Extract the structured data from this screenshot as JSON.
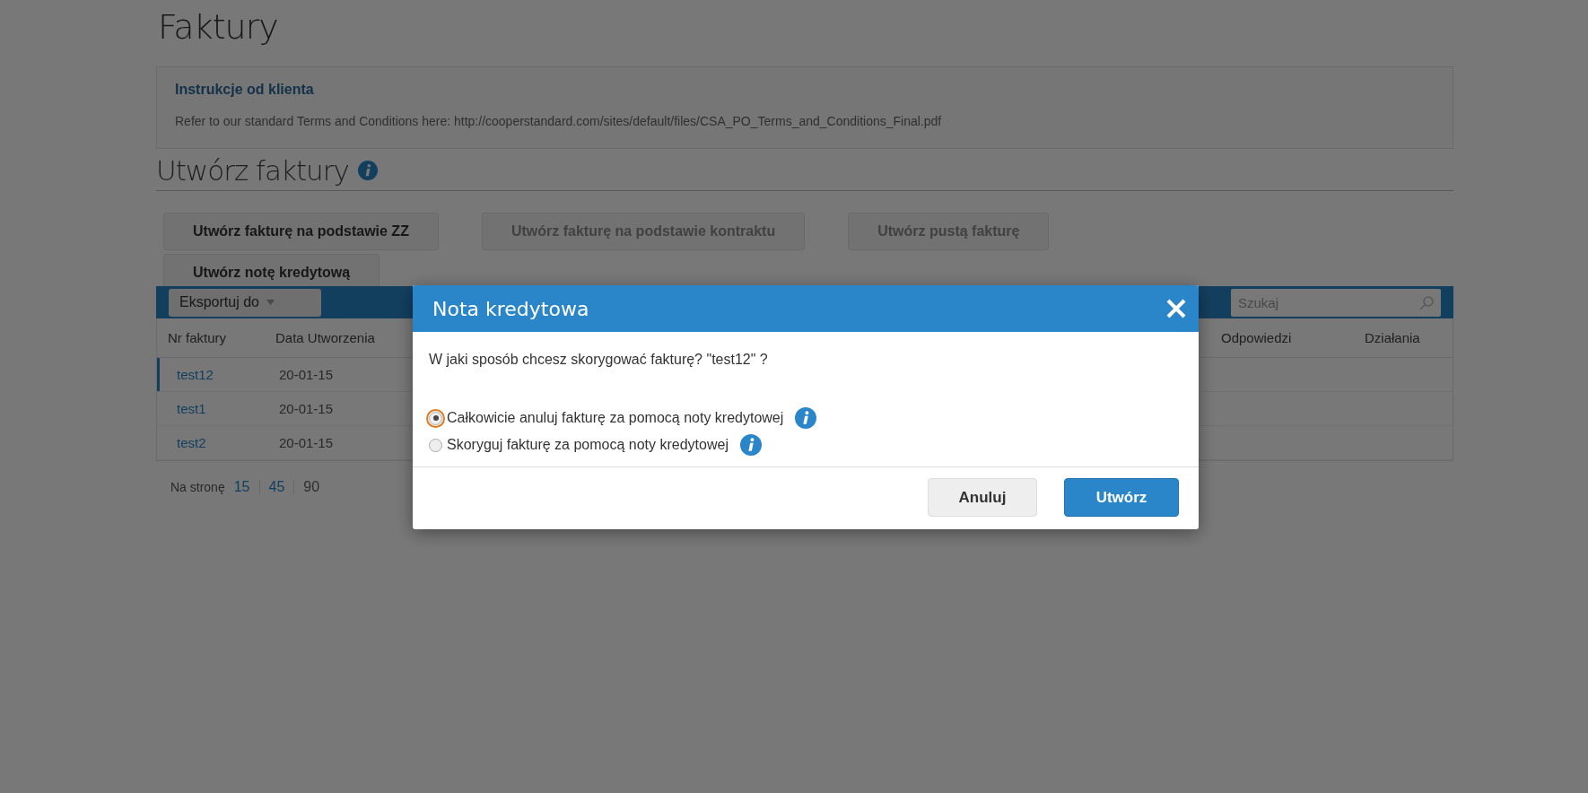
{
  "page": {
    "title": "Faktury"
  },
  "instructions": {
    "heading": "Instrukcje od klienta",
    "text": "Refer to our standard Terms and Conditions here: http://cooperstandard.com/sites/default/files/CSA_PO_Terms_and_Conditions_Final.pdf"
  },
  "create_section": {
    "title": "Utwórz faktury",
    "buttons": [
      {
        "label": "Utwórz fakturę na podstawie ZZ",
        "disabled": false
      },
      {
        "label": "Utwórz fakturę na podstawie kontraktu",
        "disabled": true
      },
      {
        "label": "Utwórz pustą fakturę",
        "disabled": true
      },
      {
        "label": "Utwórz notę kredytową",
        "disabled": false
      }
    ]
  },
  "toolbar": {
    "export": "Eksportuj do",
    "search": {
      "placeholder": "Szukaj"
    }
  },
  "table": {
    "columns": [
      "Nr faktury",
      "Data Utworzenia",
      "Odpowiedzi",
      "Działania"
    ],
    "rows": [
      {
        "number": "test12",
        "date": "20-01-15",
        "selected": true
      },
      {
        "number": "test1",
        "date": "20-01-15",
        "selected": false
      },
      {
        "number": "test2",
        "date": "20-01-15",
        "selected": false
      }
    ]
  },
  "pagination": {
    "label": "Na stronę",
    "sizes": [
      {
        "label": "15",
        "selected": false
      },
      {
        "label": "45",
        "selected": false
      },
      {
        "label": "90",
        "selected": true
      }
    ]
  },
  "dialog": {
    "title": "Nota kredytowa",
    "question": "W jaki sposób chcesz skorygować fakturę? \"test12\" ?",
    "options": [
      {
        "label": "Całkowicie anuluj fakturę za pomocą noty kredytowej",
        "selected": true,
        "focused": true
      },
      {
        "label": "Skoryguj fakturę za pomocą noty kredytowej",
        "selected": false,
        "focused": false
      }
    ],
    "buttons": [
      {
        "label": "Anuluj",
        "kind": "secondary"
      },
      {
        "label": "Utwórz",
        "kind": "primary"
      }
    ]
  }
}
